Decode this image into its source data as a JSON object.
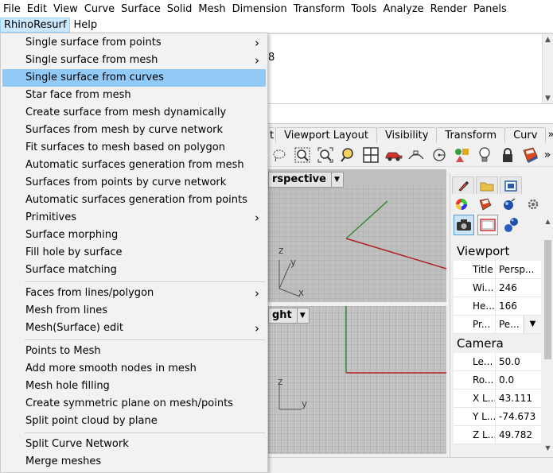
{
  "menubar": {
    "row1": [
      "File",
      "Edit",
      "View",
      "Curve",
      "Surface",
      "Solid",
      "Mesh",
      "Dimension",
      "Transform",
      "Tools",
      "Analyze",
      "Render",
      "Panels"
    ],
    "row2": [
      "RhinoResurf",
      "Help"
    ]
  },
  "command_area": {
    "partial_text": "8"
  },
  "tabs": [
    "t",
    "Viewport Layout",
    "Visibility",
    "Transform",
    "Curv"
  ],
  "tabs_more": "»",
  "toolbar_icons": [
    "lasso-select-icon",
    "zoom-window-icon",
    "zoom-extents-icon",
    "zoom-target-icon",
    "four-viewports-icon",
    "car-render-icon",
    "osnap-icon",
    "point-circle-icon",
    "shapes-icon",
    "lightbulb-icon",
    "lock-icon",
    "material-icon",
    "more-icon"
  ],
  "viewport_top": {
    "label": "rspective",
    "dropdown": "▼"
  },
  "viewport_bottom": {
    "label": "ght",
    "dropdown": "▼"
  },
  "axes": {
    "z": "z",
    "y": "y",
    "x": "x"
  },
  "menu": {
    "items": [
      {
        "label": "Single surface from points",
        "sub": true
      },
      {
        "label": "Single surface from mesh",
        "sub": true
      },
      {
        "label": "Single surface from curves",
        "sub": false,
        "highlight": true
      },
      {
        "label": "Star face from mesh",
        "sub": false
      },
      {
        "label": "Create surface from mesh dynamically",
        "sub": false
      },
      {
        "label": "Surfaces from mesh by curve network",
        "sub": false
      },
      {
        "label": "Fit surfaces to mesh based on polygon",
        "sub": false
      },
      {
        "label": "Automatic surfaces generation from mesh",
        "sub": false
      },
      {
        "label": "Surfaces from points by curve network",
        "sub": false
      },
      {
        "label": "Automatic surfaces generation from points",
        "sub": false
      },
      {
        "label": "Primitives",
        "sub": true
      },
      {
        "label": "Surface morphing",
        "sub": false
      },
      {
        "label": "Fill hole by surface",
        "sub": false
      },
      {
        "label": "Surface matching",
        "sub": false
      },
      {
        "label": "Faces from lines/polygon",
        "sub": true
      },
      {
        "label": "Mesh from lines",
        "sub": false
      },
      {
        "label": "Mesh(Surface) edit",
        "sub": true
      },
      {
        "label": "Points to Mesh",
        "sub": false
      },
      {
        "label": "Add more smooth nodes in mesh",
        "sub": false
      },
      {
        "label": "Mesh hole filling",
        "sub": false
      },
      {
        "label": "Create symmetric plane on mesh/points",
        "sub": false
      },
      {
        "label": "Split point cloud by plane",
        "sub": false
      },
      {
        "label": "Split Curve Network",
        "sub": false
      },
      {
        "label": "Merge meshes",
        "sub": false
      }
    ]
  },
  "properties": {
    "sections": [
      {
        "title": "Viewport",
        "rows": [
          {
            "key": "Title",
            "value": "Persp..."
          },
          {
            "key": "Wi...",
            "value": "246"
          },
          {
            "key": "He...",
            "value": "166"
          },
          {
            "key": "Pr...",
            "value": "Pe...",
            "dropdown": true
          }
        ]
      },
      {
        "title": "Camera",
        "rows": [
          {
            "key": "Le...",
            "value": "50.0"
          },
          {
            "key": "Ro...",
            "value": "0.0"
          },
          {
            "key": "X L...",
            "value": "43.111"
          },
          {
            "key": "Y L...",
            "value": "-74.673"
          },
          {
            "key": "Z L...",
            "value": "49.782"
          }
        ]
      }
    ]
  },
  "colors": {
    "highlight": "#91c9f7",
    "active_menu": "#cce8ff",
    "axis_red": "#b22222",
    "axis_green": "#2e8b2e",
    "grid": "#a8a8a8"
  }
}
